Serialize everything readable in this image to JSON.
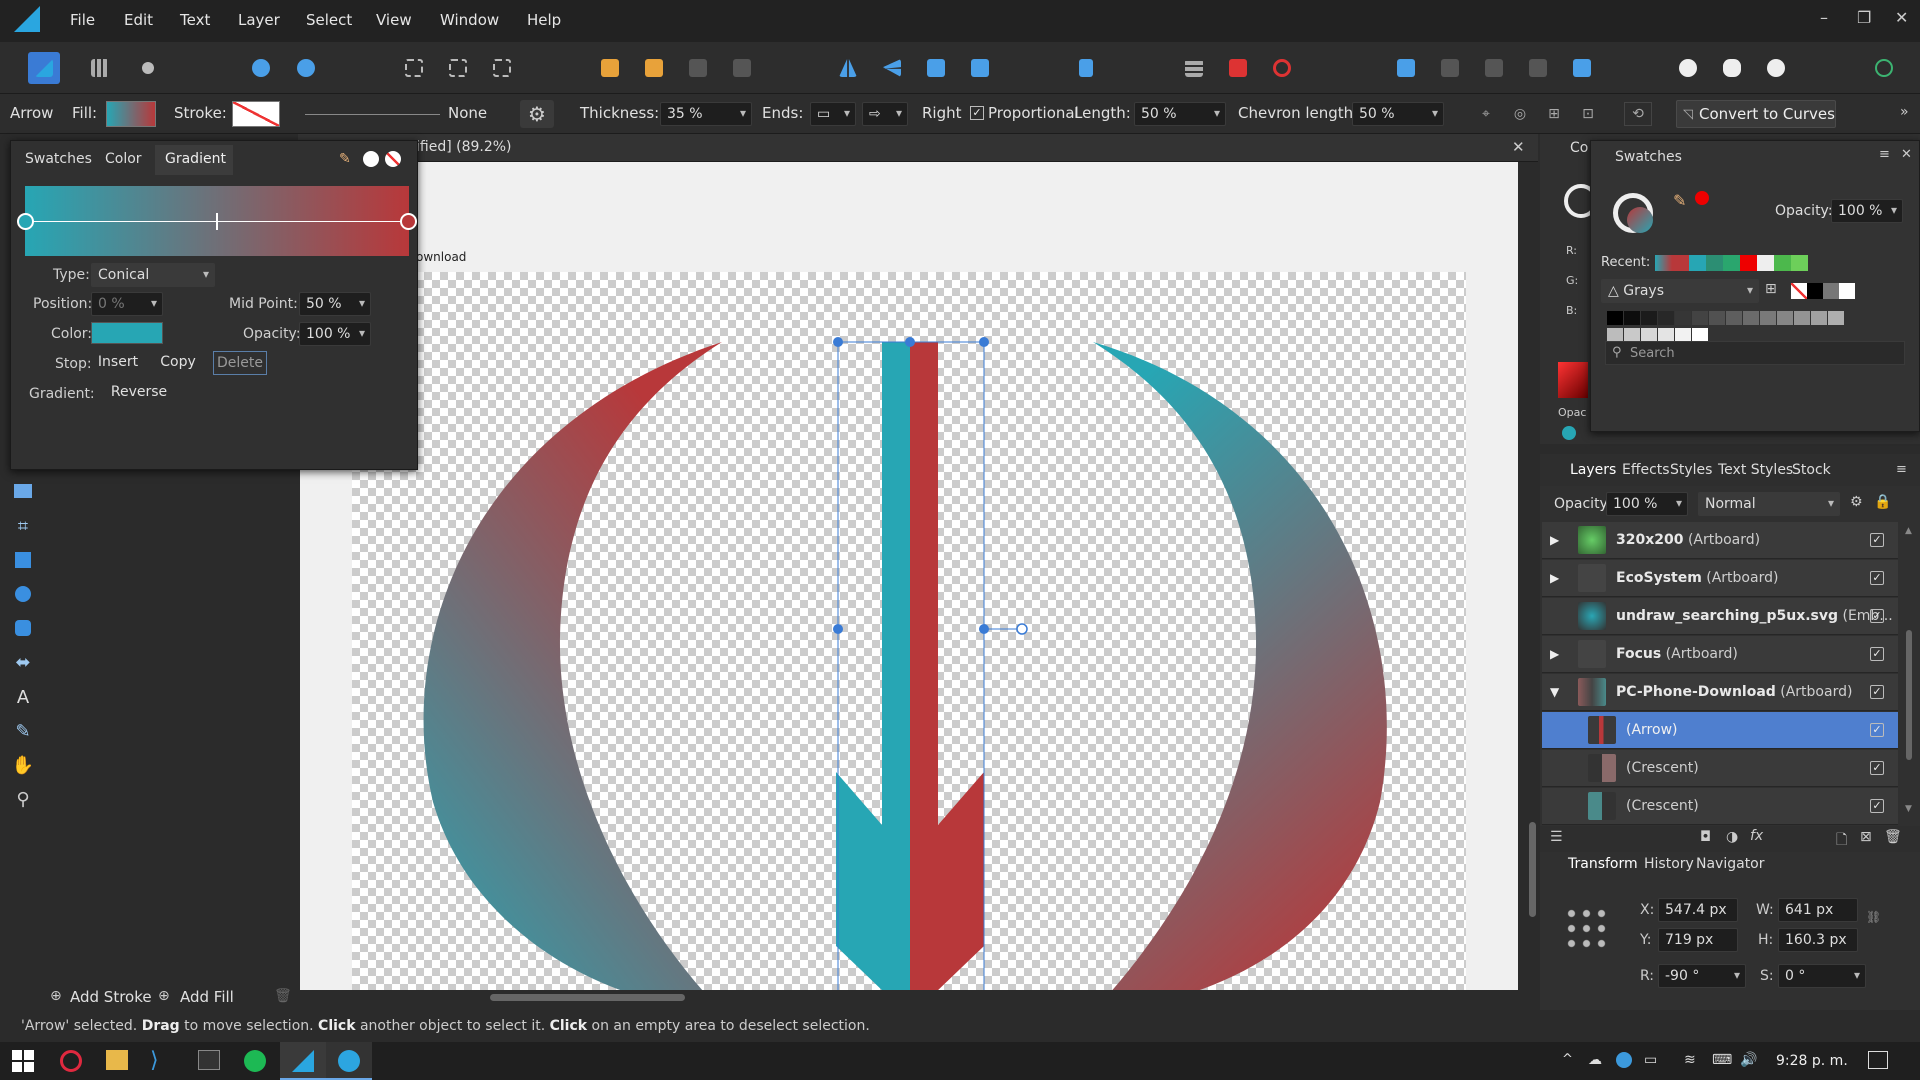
{
  "menubar": {
    "items": [
      "File",
      "Edit",
      "Text",
      "Layer",
      "Select",
      "View",
      "Window",
      "Help"
    ]
  },
  "context": {
    "tool_name": "Arrow",
    "fill_label": "Fill:",
    "stroke_label": "Stroke:",
    "stroke_style_value": "None",
    "thickness_label": "Thickness:",
    "thickness_value": "35 %",
    "ends_label": "Ends:",
    "right_label": "Right",
    "proportional_label": "Proportional",
    "length_label": "Length:",
    "length_value": "50 %",
    "chevron_label": "Chevron length:",
    "chevron_value": "50 %",
    "convert_label": "Convert to Curves"
  },
  "gradient_panel": {
    "tabs": [
      "Swatches",
      "Color",
      "Gradient"
    ],
    "type_label": "Type:",
    "type_value": "Conical",
    "position_label": "Position:",
    "position_value": "0 %",
    "midpoint_label": "Mid Point:",
    "midpoint_value": "50 %",
    "color_label": "Color:",
    "opacity_label": "Opacity:",
    "opacity_value": "100 %",
    "stop_label": "Stop:",
    "insert_label": "Insert",
    "copy_label": "Copy",
    "delete_label": "Delete",
    "gradient_label": "Gradient:",
    "reverse_label": "Reverse",
    "start_color": "#27a6b4",
    "end_color": "#b8383a"
  },
  "document": {
    "tab_title": "ified] (89.2%)",
    "artboard_label": "ownload"
  },
  "swatches_panel": {
    "title": "Swatches",
    "opacity_label": "Opacity:",
    "opacity_value": "100 %",
    "recent_label": "Recent:",
    "palette_name": "Grays",
    "search_placeholder": "Search",
    "partial_tab": "Co",
    "rgb_labels": [
      "R:",
      "G:",
      "B:"
    ],
    "opac_label": "Opac"
  },
  "layers_panel": {
    "tabs": [
      "Layers",
      "Effects",
      "Styles",
      "Text Styles",
      "Stock"
    ],
    "opacity_label": "Opacity:",
    "opacity_value": "100 %",
    "blend_mode": "Normal",
    "rows": [
      {
        "name": "320x200",
        "kind": "(Artboard)"
      },
      {
        "name": "EcoSystem",
        "kind": "(Artboard)"
      },
      {
        "name": "undraw_searching_p5ux.svg",
        "kind": "(Emb..."
      },
      {
        "name": "Focus",
        "kind": "(Artboard)"
      },
      {
        "name": "PC-Phone-Download",
        "kind": "(Artboard)"
      },
      {
        "name": "",
        "kind": "(Arrow)"
      },
      {
        "name": "",
        "kind": "(Crescent)"
      },
      {
        "name": "",
        "kind": "(Crescent)"
      }
    ]
  },
  "transform_panel": {
    "tabs": [
      "Transform",
      "History",
      "Navigator"
    ],
    "x_label": "X:",
    "x_value": "547.4 px",
    "w_label": "W:",
    "w_value": "641 px",
    "y_label": "Y:",
    "y_value": "719 px",
    "h_label": "H:",
    "h_value": "160.3 px",
    "r_label": "R:",
    "r_value": "-90 °",
    "s_label": "S:",
    "s_value": "0 °"
  },
  "bottom": {
    "add_stroke": "Add Stroke",
    "add_fill": "Add Fill"
  },
  "status": {
    "p1": "'Arrow' selected. ",
    "b1": "Drag",
    "p2": " to move selection. ",
    "b2": "Click",
    "p3": " another object to select it. ",
    "b3": "Click",
    "p4": " on an empty area to deselect selection."
  },
  "taskbar": {
    "time": "9:28 p. m."
  }
}
